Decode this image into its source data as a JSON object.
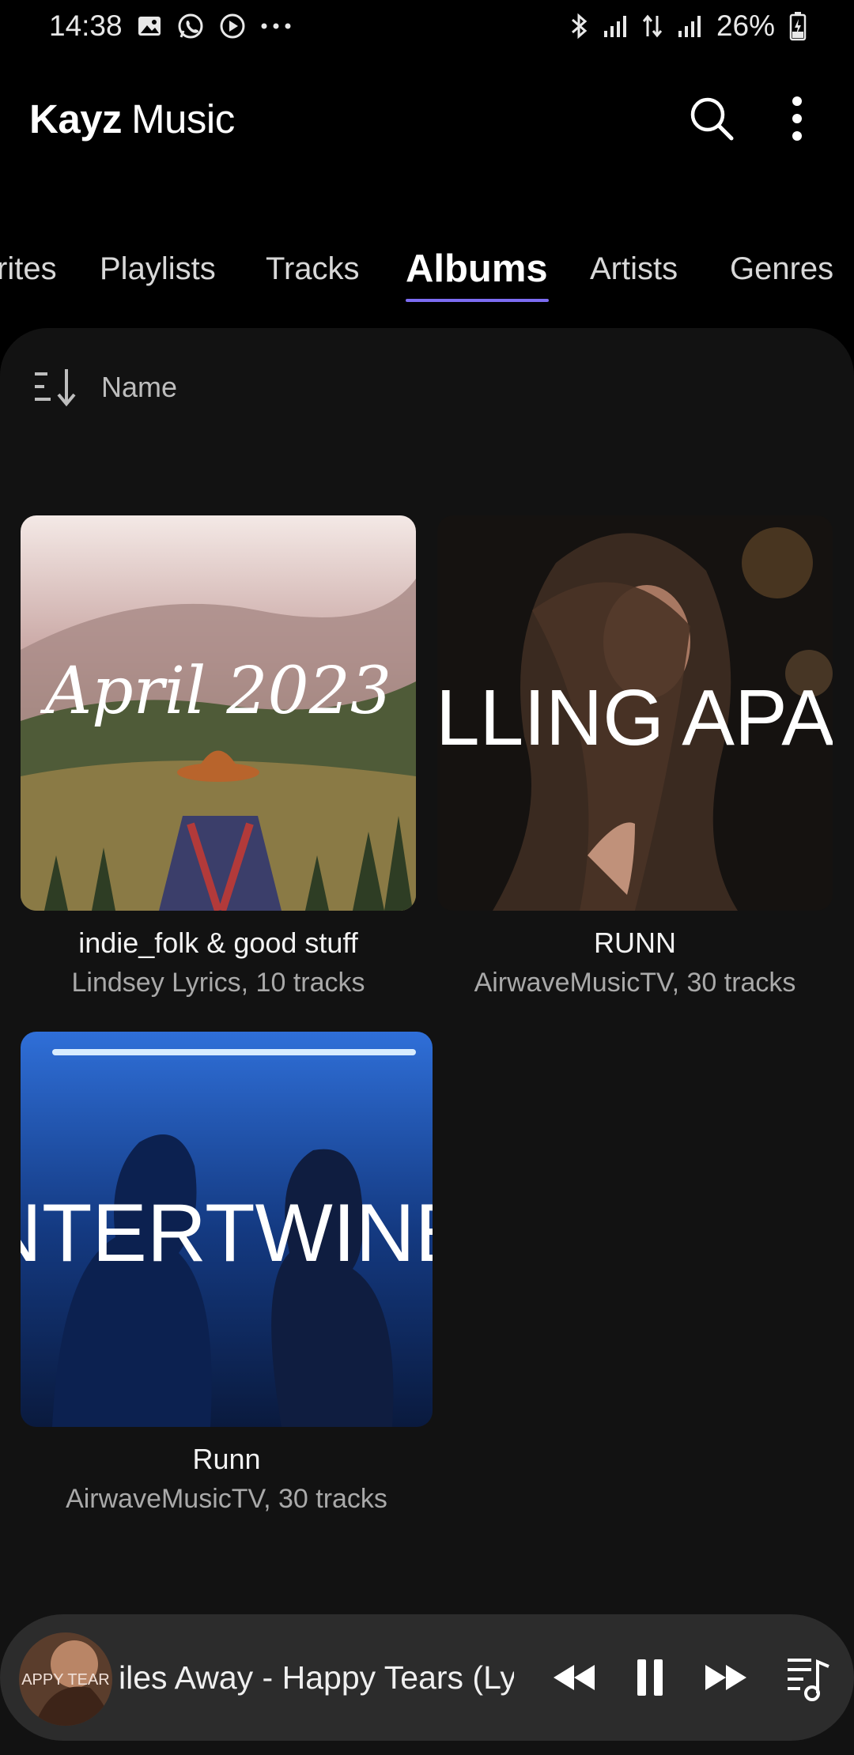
{
  "status_bar": {
    "time": "14:38",
    "left_icons": [
      "gallery-icon",
      "whatsapp-icon",
      "play-circle-icon",
      "more-dots-icon"
    ],
    "right_icons": [
      "bluetooth-icon",
      "signal-icon",
      "data-arrows-icon",
      "signal-icon"
    ],
    "battery": "26%"
  },
  "app_bar": {
    "title_bold": "Kayz",
    "title_light": "Music",
    "actions": [
      "search-icon",
      "more-vert-icon"
    ]
  },
  "tabs": [
    {
      "label": "Favorites",
      "visible_label": "rites",
      "active": false
    },
    {
      "label": "Playlists",
      "active": false
    },
    {
      "label": "Tracks",
      "active": false
    },
    {
      "label": "Albums",
      "active": true
    },
    {
      "label": "Artists",
      "active": false
    },
    {
      "label": "Genres",
      "active": false
    }
  ],
  "accent_color": "#7c6cf2",
  "sort": {
    "icon": "sort-icon",
    "label": "Name"
  },
  "albums": [
    {
      "title": "indie_folk & good stuff",
      "subtitle": "Lindsey Lyrics, 10 tracks",
      "art_text": "April 2023"
    },
    {
      "title": "RUNN",
      "subtitle": "AirwaveMusicTV, 30 tracks",
      "art_text": "LLING APA"
    },
    {
      "title": "Runn",
      "subtitle": "AirwaveMusicTV, 30 tracks",
      "art_text": "NTERTWINE"
    }
  ],
  "player": {
    "art_text": "APPY TEAR",
    "title": "iles Away - Happy Tears (Ly",
    "controls": [
      "rewind-icon",
      "pause-icon",
      "fast-forward-icon",
      "queue-music-icon"
    ]
  }
}
